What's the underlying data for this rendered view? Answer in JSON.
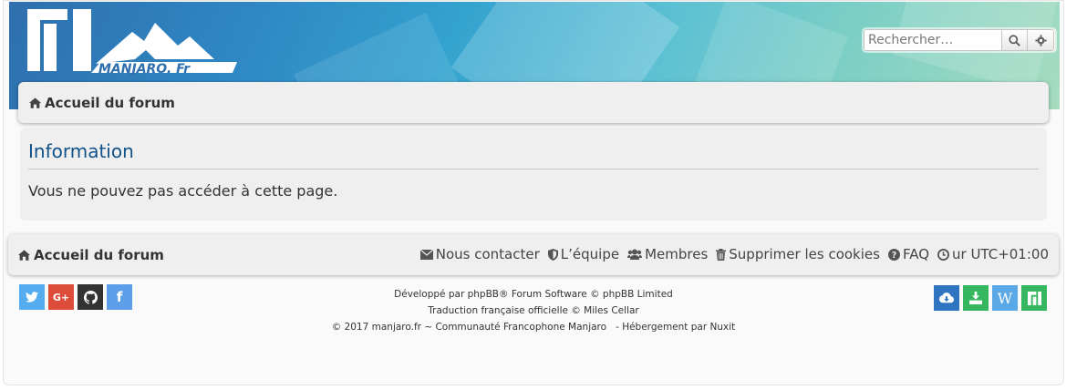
{
  "header": {
    "logo_text": "MANJARO. Fr",
    "search": {
      "placeholder": "Rechercher…"
    }
  },
  "breadcrumb": {
    "home_label": "Accueil du forum"
  },
  "panel": {
    "title": "Information",
    "message": "Vous ne pouvez pas accéder à cette page."
  },
  "footer_nav": {
    "home_label": "Accueil du forum",
    "links": [
      {
        "label": "Nous contacter",
        "icon": "envelope-icon"
      },
      {
        "label": "L’équipe",
        "icon": "shield-icon"
      },
      {
        "label": "Membres",
        "icon": "users-icon"
      },
      {
        "label": "Supprimer les cookies",
        "icon": "trash-icon"
      },
      {
        "label": "FAQ",
        "icon": "question-circle-icon"
      },
      {
        "label": "ur UTC+01:00",
        "icon": "clock-icon"
      }
    ]
  },
  "social": [
    {
      "name": "twitter",
      "color": "#55acee",
      "glyph": ""
    },
    {
      "name": "google-plus",
      "color": "#dd4b39",
      "glyph": "G+"
    },
    {
      "name": "github",
      "color": "#333333",
      "glyph": ""
    },
    {
      "name": "facebook",
      "color": "#5d9ee8",
      "glyph": "f"
    }
  ],
  "credits": {
    "line1": "Développé par phpBB® Forum Software © phpBB Limited",
    "line2": "Traduction française officielle © Miles Cellar",
    "line3": "© 2017 manjaro.fr ~ Communauté Francophone Manjaro   - Hébergement par Nuxit"
  },
  "right_icons": [
    {
      "name": "cloud-download",
      "color": "#2f74c0",
      "glyph": ""
    },
    {
      "name": "download",
      "color": "#35b75f",
      "glyph": ""
    },
    {
      "name": "wiki",
      "color": "#5aa9e6",
      "glyph": "W"
    },
    {
      "name": "manjaro",
      "color": "#35b75f",
      "glyph": ""
    }
  ]
}
